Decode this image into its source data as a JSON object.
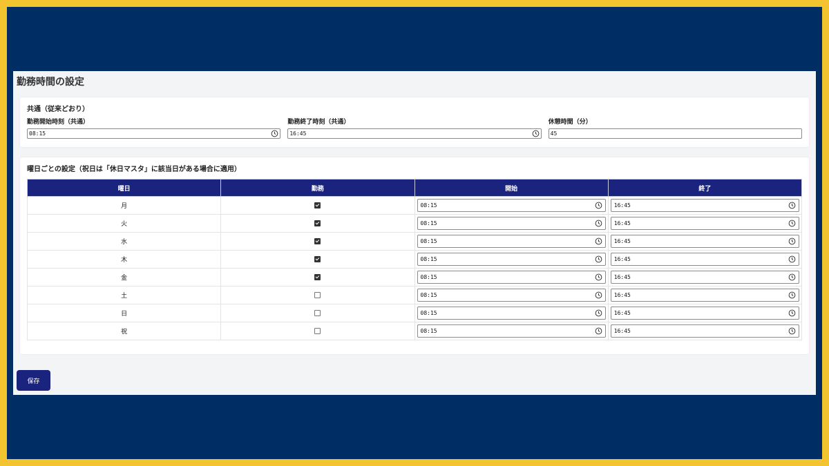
{
  "page": {
    "title": "勤務時間の設定"
  },
  "common": {
    "title": "共通（従来どおり）",
    "start_label": "勤務開始時刻（共通）",
    "start_value": "08:15",
    "end_label": "勤務終了時刻（共通）",
    "end_value": "16:45",
    "break_label": "休憩時間（分）",
    "break_value": "45"
  },
  "weekly": {
    "title": "曜日ごとの設定（祝日は「休日マスタ」に該当日がある場合に適用）",
    "headers": [
      "曜日",
      "勤務",
      "開始",
      "終了"
    ],
    "rows": [
      {
        "day": "月",
        "work": true,
        "start": "08:15",
        "end": "16:45"
      },
      {
        "day": "火",
        "work": true,
        "start": "08:15",
        "end": "16:45"
      },
      {
        "day": "水",
        "work": true,
        "start": "08:15",
        "end": "16:45"
      },
      {
        "day": "木",
        "work": true,
        "start": "08:15",
        "end": "16:45"
      },
      {
        "day": "金",
        "work": true,
        "start": "08:15",
        "end": "16:45"
      },
      {
        "day": "土",
        "work": false,
        "start": "08:15",
        "end": "16:45"
      },
      {
        "day": "日",
        "work": false,
        "start": "08:15",
        "end": "16:45"
      },
      {
        "day": "祝",
        "work": false,
        "start": "08:15",
        "end": "16:45"
      }
    ]
  },
  "actions": {
    "save_label": "保存"
  },
  "colors": {
    "frame": "#f4c430",
    "background": "#002d64",
    "accent": "#1a237e"
  },
  "icons": {
    "time_input": "clock-icon"
  }
}
